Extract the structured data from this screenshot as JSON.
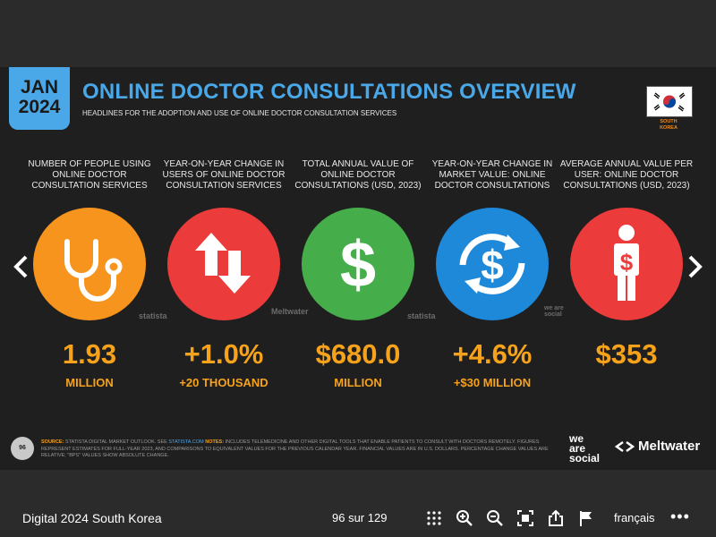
{
  "slide": {
    "date_month": "JAN",
    "date_year": "2024",
    "title": "ONLINE DOCTOR CONSULTATIONS OVERVIEW",
    "subtitle": "HEADLINES FOR THE ADOPTION AND USE OF ONLINE DOCTOR CONSULTATION SERVICES",
    "flag_label": [
      "SOUTH",
      "KOREA"
    ],
    "page_number": "96",
    "footnote_source_label": "SOURCE:",
    "footnote_source": " STATISTA DIGITAL MARKET OUTLOOK. SEE ",
    "footnote_link": "STATISTA.COM",
    "footnote_notes_label": " NOTES:",
    "footnote_notes": " INCLUDES TELEMEDICINE AND OTHER DIGITAL TOOLS THAT ENABLE PATIENTS TO CONSULT WITH DOCTORS REMOTELY. FIGURES REPRESENT ESTIMATES FOR FULL-YEAR 2023, AND COMPARISONS TO EQUIVALENT VALUES FOR THE PREVIOUS CALENDAR YEAR. FINANCIAL VALUES ARE IN U.S. DOLLARS. PERCENTAGE CHANGE VALUES ARE RELATIVE; \"BPS\" VALUES SHOW ABSOLUTE CHANGE.",
    "brand_ws": [
      "we",
      "are",
      "social"
    ],
    "brand_mw": "Meltwater",
    "source_marks": [
      "statista",
      "Meltwater",
      "statista",
      "we are social"
    ],
    "metrics": [
      {
        "label": "NUMBER OF PEOPLE USING ONLINE DOCTOR CONSULTATION SERVICES",
        "value": "1.93",
        "sub": "MILLION",
        "color": "#f7941d",
        "icon": "stethoscope-icon"
      },
      {
        "label": "YEAR-ON-YEAR CHANGE IN USERS OF ONLINE DOCTOR CONSULTATION SERVICES",
        "value": "+1.0%",
        "sub": "+20 THOUSAND",
        "color": "#ec3b3b",
        "icon": "up-down-arrows-icon"
      },
      {
        "label": "TOTAL ANNUAL VALUE OF ONLINE DOCTOR CONSULTATIONS (USD, 2023)",
        "value": "$680.0",
        "sub": "MILLION",
        "color": "#45ad49",
        "icon": "dollar-icon"
      },
      {
        "label": "YEAR-ON-YEAR CHANGE IN MARKET VALUE: ONLINE DOCTOR CONSULTATIONS",
        "value": "+4.6%",
        "sub": "+$30 MILLION",
        "color": "#1e88d9",
        "icon": "dollar-exchange-icon"
      },
      {
        "label": "AVERAGE ANNUAL VALUE PER USER: ONLINE DOCTOR CONSULTATIONS (USD, 2023)",
        "value": "$353",
        "sub": "",
        "color": "#ec3b3b",
        "icon": "person-dollar-icon"
      }
    ]
  },
  "toolbar": {
    "doc_title": "Digital 2024 South Korea",
    "pages": "96 sur 129",
    "language": "français",
    "more": "•••",
    "icons": [
      "grid-icon",
      "zoom-in-icon",
      "zoom-out-icon",
      "fullscreen-icon",
      "share-icon",
      "flag-icon"
    ]
  }
}
